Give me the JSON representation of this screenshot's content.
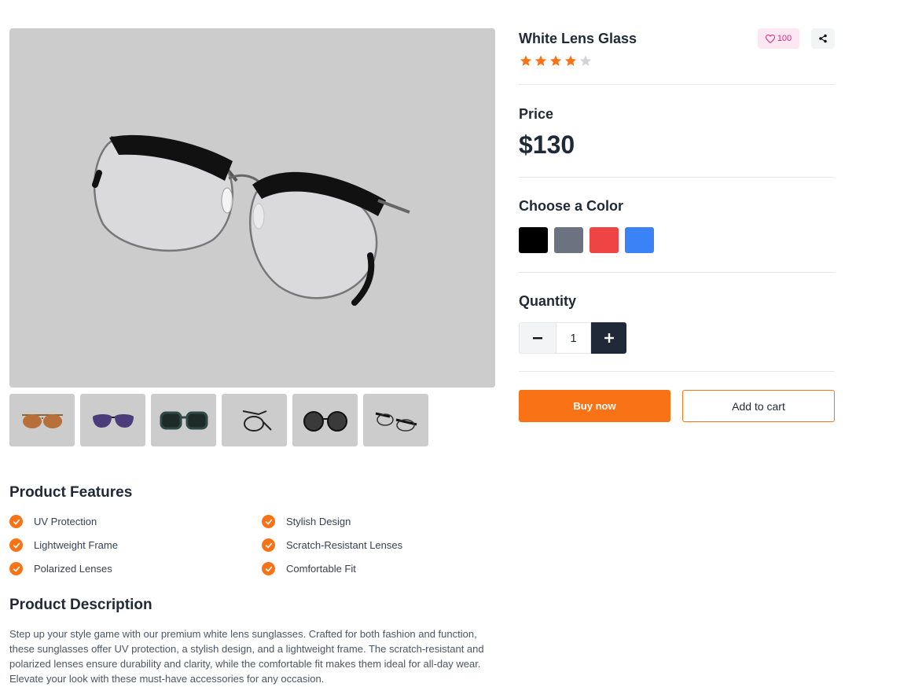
{
  "gallery": {
    "main_image": "eyeglasses-clear-lens-photo",
    "thumbnails": [
      "brown-aviator-sunglasses",
      "purple-cat-eye-sunglasses",
      "green-square-sunglasses",
      "folded-wire-glasses",
      "dark-round-sunglasses",
      "black-browline-glasses"
    ]
  },
  "product": {
    "title": "White Lens Glass",
    "likes": "100",
    "rating": 4,
    "rating_max": 5,
    "price_label": "Price",
    "price": "$130"
  },
  "color": {
    "label": "Choose a Color",
    "options": [
      "#000000",
      "#6b7280",
      "#ef4444",
      "#3b82f6"
    ]
  },
  "quantity": {
    "label": "Quantity",
    "value": "1"
  },
  "actions": {
    "buy_now": "Buy now",
    "add_to_cart": "Add to cart"
  },
  "features": {
    "title": "Product Features",
    "items": [
      "UV Protection",
      "Stylish Design",
      "Lightweight Frame",
      "Scratch-Resistant Lenses",
      "Polarized Lenses",
      "Comfortable Fit"
    ]
  },
  "description": {
    "title": "Product Description",
    "text": "Step up your style game with our premium white lens sunglasses. Crafted for both fashion and function, these sunglasses offer UV protection, a stylish design, and a lightweight frame. The scratch-resistant and polarized lenses ensure durability and clarity, while the comfortable fit makes them ideal for all-day wear. Elevate your look with these must-have accessories for any occasion."
  },
  "colors": {
    "accent": "#f97316",
    "dark": "#1f2937",
    "image_bg": "#cccccc",
    "like_bg": "#fce7f3",
    "like_fg": "#db2777"
  }
}
